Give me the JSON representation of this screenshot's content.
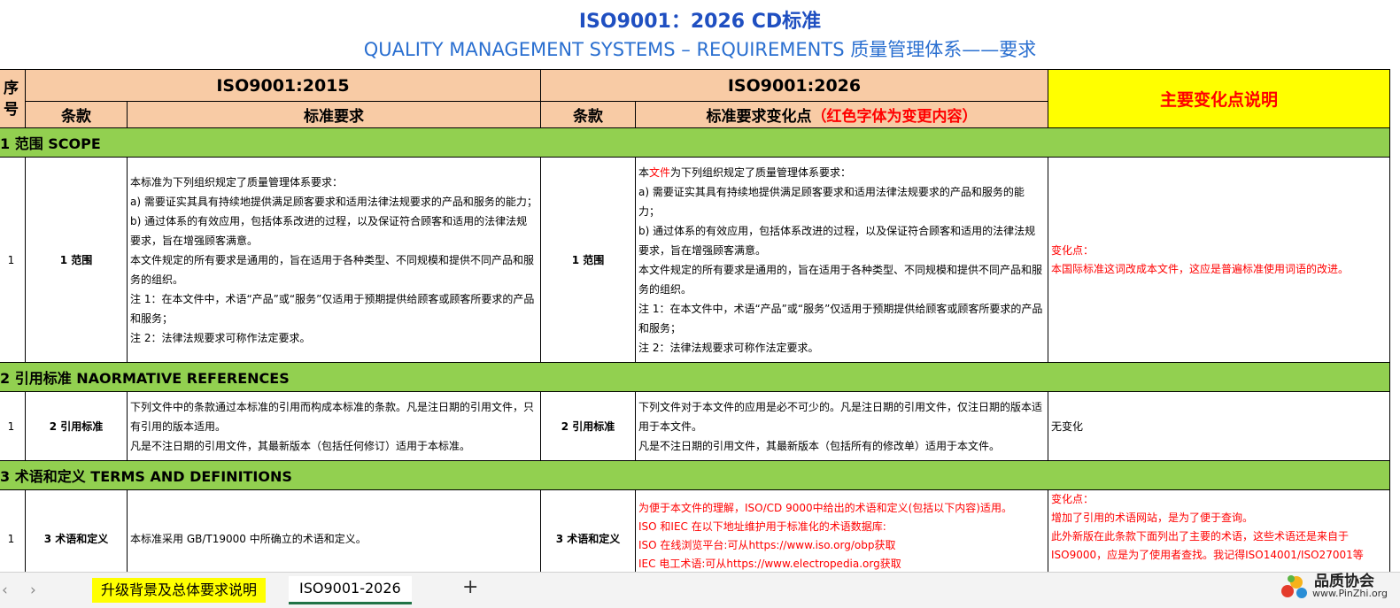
{
  "title": {
    "line1": "ISO9001：2026 CD标准",
    "line2": "QUALITY MANAGEMENT SYSTEMS – REQUIREMENTS 质量管理体系——要求"
  },
  "header": {
    "seq": "序号",
    "seq_top": "序",
    "seq_bottom": "号",
    "std2015": "ISO9001:2015",
    "std2026": "ISO9001:2026",
    "clause_label": "条款",
    "requirement_label": "标准要求",
    "change_label_black": "标准要求变化点",
    "change_label_red": "（红色字体为变更内容）",
    "main_change": "主要变化点说明"
  },
  "sections": {
    "s1": "1 范围 SCOPE",
    "s2": "2 引用标准 NAORMATIVE REFERENCES",
    "s3": "3 术语和定义 TERMS AND DEFINITIONS"
  },
  "rows": {
    "r1": {
      "num": "1",
      "clause2015": "1 范围",
      "clause2026": "1 范围",
      "text2015": [
        "本标准为下列组织规定了质量管理体系要求：",
        "a) 需要证实其具有持续地提供满足顾客要求和适用法律法规要求的产品和服务的能力；",
        "b) 通过体系的有效应用，包括体系改进的过程，以及保证符合顾客和适用的法律法规要求，旨在增强顾客满意。",
        "本文件规定的所有要求是通用的，旨在适用于各种类型、不同规模和提供不同产品和服务的组织。",
        "注 1：在本文件中，术语“产品”或“服务”仅适用于预期提供给顾客或顾客所要求的产品和服务；",
        "注 2：法律法规要求可称作法定要求。"
      ],
      "text2026_prefix": "本",
      "text2026_red": "文件",
      "text2026_rest": "为下列组织规定了质量管理体系要求：",
      "text2026": [
        "a) 需要证实其具有持续地提供满足顾客要求和适用法律法规要求的产品和服务的能力；",
        "b) 通过体系的有效应用，包括体系改进的过程，以及保证符合顾客和适用的法律法规要求，旨在增强顾客满意。",
        "本文件规定的所有要求是通用的，旨在适用于各种类型、不同规模和提供不同产品和服务的组织。",
        "注 1：在本文件中，术语“产品”或“服务”仅适用于预期提供给顾客或顾客所要求的产品和服务；",
        "注 2：法律法规要求可称作法定要求。"
      ],
      "note": [
        "变化点：",
        "本国际标准这词改成本文件，这应是普遍标准使用词语的改进。"
      ]
    },
    "r2": {
      "num": "1",
      "clause2015": "2 引用标准",
      "clause2026": "2 引用标准",
      "text2015": [
        "下列文件中的条款通过本标准的引用而构成本标准的条款。凡是注日期的引用文件，只有引用的版本适用。",
        "凡是不注日期的引用文件，其最新版本（包括任何修订）适用于本标准。"
      ],
      "text2026": [
        "下列文件对于本文件的应用是必不可少的。凡是注日期的引用文件，仅注日期的版本适用于本文件。",
        "凡是不注日期的引用文件，其最新版本（包括所有的修改单）适用于本文件。"
      ],
      "note": "无变化"
    },
    "r3": {
      "num": "1",
      "clause2015": "3 术语和定义",
      "clause2026": "3 术语和定义",
      "text2015": "本标准采用 GB/T19000 中所确立的术语和定义。",
      "text2026": [
        "为便于本文件的理解，ISO/CD 9000中给出的术语和定义(包括以下内容)适用。",
        "ISO 和IEC 在以下地址维护用于标准化的术语数据库:",
        "ISO 在线浏览平台:可从https://www.iso.org/obp获取",
        "IEC 电工术语:可从https://www.electropedia.org获取"
      ],
      "note": [
        "变化点：",
        "增加了引用的术语网站，是为了便于查询。",
        "此外新版在此条款下面列出了主要的术语，这些术语还是来自于ISO9000，应是为了使用者查找。我记得ISO14001/ISO27001等"
      ]
    }
  },
  "tabs": {
    "tab1": "升级背景及总体要求说明",
    "tab2": "ISO9001-2026",
    "add": "+",
    "prev": "‹",
    "next": "›"
  },
  "watermark": {
    "name": "品质协会",
    "url": "www.PinZhi.org"
  },
  "colors": {
    "header_bg": "#f8cba5",
    "section_bg": "#92d050",
    "highlight": "#ffff00",
    "change_red": "#ff0000",
    "title_blue": "#1f4fc1"
  }
}
